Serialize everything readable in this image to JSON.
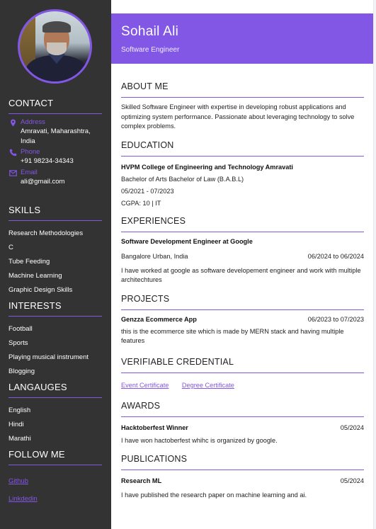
{
  "profile": {
    "name": "Sohail Ali",
    "role": "Software Engineer"
  },
  "sidebar": {
    "contact": {
      "title": "CONTACT",
      "address_label": "Address",
      "address_line1": "Amravati, Maharashtra,",
      "address_line2": "India",
      "phone_label": "Phone",
      "phone_value": "+91 98234-34343",
      "email_label": "Email",
      "email_value": "ali@gmail.com"
    },
    "skills": {
      "title": "SKILLS",
      "items": [
        "Research Methodologies",
        "C",
        "Tube Feeding",
        "Machine Learning",
        "Graphic Design Skills"
      ]
    },
    "interests": {
      "title": "INTERESTS",
      "items": [
        "Football",
        "Sports",
        "Playing musical instrument",
        "Blogging"
      ]
    },
    "languages": {
      "title": "LANGAUGES",
      "items": [
        "English",
        "Hindi",
        "Marathi"
      ]
    },
    "follow": {
      "title": "FOLLOW ME",
      "links": [
        "Github",
        "Linkdedin"
      ]
    }
  },
  "main": {
    "about": {
      "title": "ABOUT ME",
      "text": "Skilled Software Engineer with expertise in developing robust applications and optimizing system performance. Passionate about leveraging technology to solve complex problems."
    },
    "education": {
      "title": "EDUCATION",
      "institution": "HVPM College of Engineering and Technology Amravati",
      "degree": "Bachelor of Arts Bachelor of Law (B.A.B.L)",
      "dates": "05/2021 - 07/2023",
      "grade": "CGPA: 10 | IT"
    },
    "experience": {
      "title": "EXPERIENCES",
      "position": "Software Development Engineer at Google",
      "location": "Bangalore Urban, India",
      "dates": "06/2024 to 06/2024",
      "description": "I have worked at google as software developement engineer and work with multiple architechtures"
    },
    "projects": {
      "title": "PROJECTS",
      "name": "Genzza Ecommerce App",
      "dates": "06/2023 to 07/2023",
      "description": "this is the ecommerce site which is made by MERN stack and having multiple features"
    },
    "credentials": {
      "title": "VERIFIABLE CREDENTIAL",
      "links": [
        "Event Certificate",
        "Degree Certificate"
      ]
    },
    "awards": {
      "title": "AWARDS",
      "name": "Hacktoberfest Winner",
      "date": "05/2024",
      "description": "I have won hactoberfest whihc is organized by google."
    },
    "publications": {
      "title": "PUBLICATIONS",
      "name": "Research ML",
      "date": "05/2024",
      "description": "I have published the research paper on machine learning and ai."
    }
  },
  "colors": {
    "accent": "#8257e6",
    "sidebar_bg": "#333333"
  }
}
